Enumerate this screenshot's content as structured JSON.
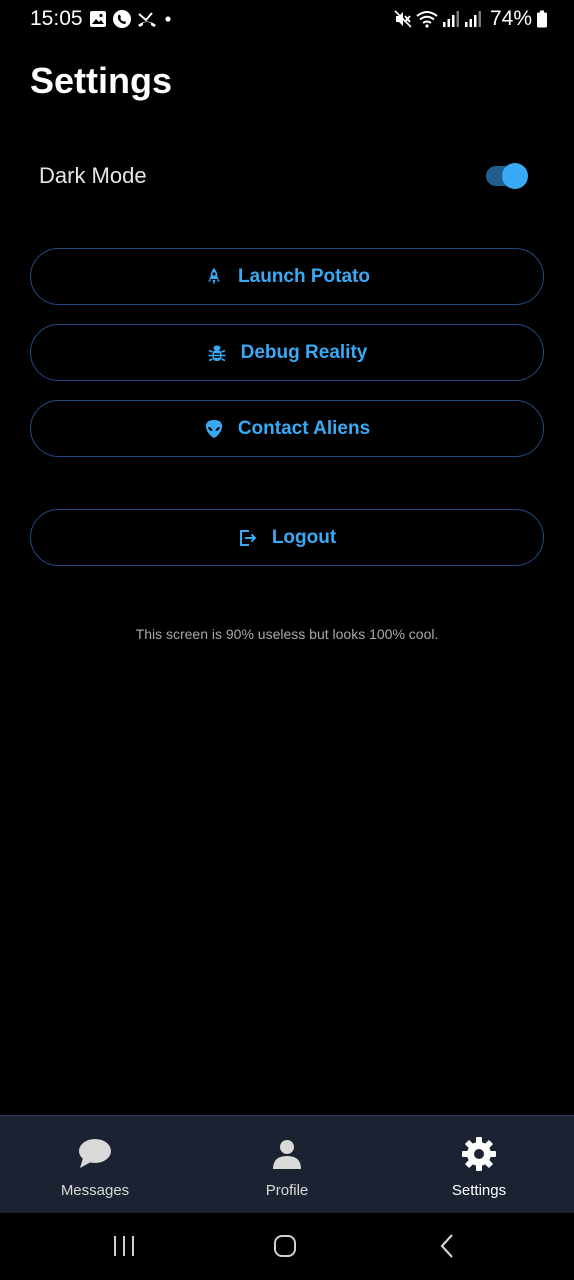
{
  "status_bar": {
    "time": "15:05",
    "battery": "74%",
    "left_icons": [
      "gallery-icon",
      "whatsapp-icon",
      "missed-call-icon",
      "notification-dot-icon"
    ],
    "right_icons": [
      "mute-icon",
      "wifi-icon",
      "signal-icon",
      "signal-icon",
      "battery-icon"
    ]
  },
  "page": {
    "title": "Settings"
  },
  "dark_mode": {
    "label": "Dark Mode",
    "enabled": true
  },
  "actions": [
    {
      "label": "Launch Potato",
      "icon": "rocket-icon"
    },
    {
      "label": "Debug Reality",
      "icon": "bug-icon"
    },
    {
      "label": "Contact Aliens",
      "icon": "alien-icon"
    }
  ],
  "logout": {
    "label": "Logout",
    "icon": "logout-icon"
  },
  "footer_note": "This screen is 90% useless but looks 100% cool.",
  "bottom_nav": {
    "items": [
      {
        "label": "Messages",
        "icon": "chat-bubble-icon",
        "active": false
      },
      {
        "label": "Profile",
        "icon": "person-icon",
        "active": false
      },
      {
        "label": "Settings",
        "icon": "gear-icon",
        "active": true
      }
    ]
  },
  "system_nav": [
    "recents-button",
    "home-button",
    "back-button"
  ],
  "colors": {
    "accent": "#3aa9f5",
    "button_border": "#234a80",
    "background": "#000000",
    "nav_background": "#1b2231",
    "inactive_nav": "#d9d9d9"
  }
}
